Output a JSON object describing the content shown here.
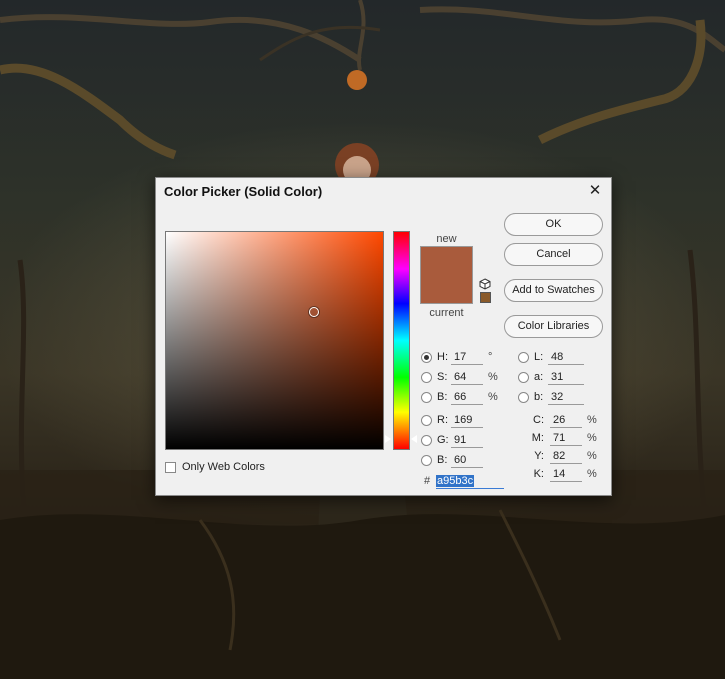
{
  "dialog": {
    "title": "Color Picker (Solid Color)",
    "close_glyph": "✕",
    "only_web_colors_label": "Only Web Colors",
    "new_label": "new",
    "current_label": "current",
    "new_color": "#a95b3c",
    "current_color": "#a95b3c"
  },
  "buttons": {
    "ok": "OK",
    "cancel": "Cancel",
    "add_to_swatches": "Add to Swatches",
    "color_libraries": "Color Libraries"
  },
  "hsb": {
    "h": {
      "label": "H:",
      "value": "17",
      "unit": "°"
    },
    "s": {
      "label": "S:",
      "value": "64",
      "unit": "%"
    },
    "b": {
      "label": "B:",
      "value": "66",
      "unit": "%"
    }
  },
  "rgb": {
    "r": {
      "label": "R:",
      "value": "169"
    },
    "g": {
      "label": "G:",
      "value": "91"
    },
    "b": {
      "label": "B:",
      "value": "60"
    }
  },
  "lab": {
    "l": {
      "label": "L:",
      "value": "48"
    },
    "a": {
      "label": "a:",
      "value": "31"
    },
    "b": {
      "label": "b:",
      "value": "32"
    }
  },
  "cmyk": {
    "c": {
      "label": "C:",
      "value": "26",
      "unit": "%"
    },
    "m": {
      "label": "M:",
      "value": "71",
      "unit": "%"
    },
    "y": {
      "label": "Y:",
      "value": "82",
      "unit": "%"
    },
    "k": {
      "label": "K:",
      "value": "14",
      "unit": "%"
    }
  },
  "hex": {
    "hash": "#",
    "value": "a95b3c"
  },
  "icons": {
    "close": "close-icon",
    "gamut_cube": "cube-icon"
  }
}
